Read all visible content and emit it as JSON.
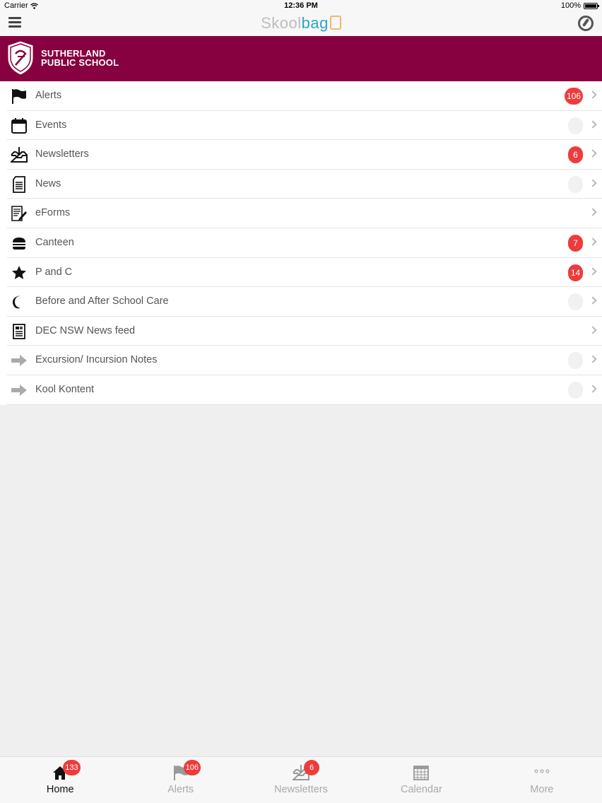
{
  "status_bar": {
    "carrier": "Carrier",
    "time": "12:36 PM",
    "battery": "100%"
  },
  "nav": {
    "logo_part1": "Skool",
    "logo_part2": "bag"
  },
  "school": {
    "name_line1": "SUTHERLAND",
    "name_line2": "PUBLIC SCHOOL"
  },
  "menu": {
    "items": [
      {
        "label": "Alerts",
        "icon": "flag-icon",
        "badge": "106"
      },
      {
        "label": "Events",
        "icon": "calendar-icon",
        "badge": "0"
      },
      {
        "label": "Newsletters",
        "icon": "inbox-download-icon",
        "badge": "6"
      },
      {
        "label": "News",
        "icon": "document-icon",
        "badge": "0"
      },
      {
        "label": "eForms",
        "icon": "form-pencil-icon",
        "badge": ""
      },
      {
        "label": "Canteen",
        "icon": "burger-icon",
        "badge": "7"
      },
      {
        "label": "P and C",
        "icon": "star-icon",
        "badge": "14"
      },
      {
        "label": "Before and After School Care",
        "icon": "moon-icon",
        "badge": "0"
      },
      {
        "label": "DEC NSW News feed",
        "icon": "newspaper-icon",
        "badge": ""
      },
      {
        "label": "Excursion/ Incursion Notes",
        "icon": "arrow-right-icon",
        "badge": "0"
      },
      {
        "label": "Kool Kontent",
        "icon": "arrow-right-icon",
        "badge": "0"
      }
    ]
  },
  "tabs": [
    {
      "label": "Home",
      "icon": "home-icon",
      "badge": "133",
      "active": true
    },
    {
      "label": "Alerts",
      "icon": "flag-icon",
      "badge": "106",
      "active": false
    },
    {
      "label": "Newsletters",
      "icon": "inbox-download-icon",
      "badge": "6",
      "active": false
    },
    {
      "label": "Calendar",
      "icon": "calendar-grid-icon",
      "badge": "",
      "active": false
    },
    {
      "label": "More",
      "icon": "more-dots-icon",
      "badge": "",
      "active": false
    }
  ],
  "colors": {
    "banner": "#870040",
    "badge": "#ec3c3c",
    "logo_accent": "#2aa6c9"
  }
}
